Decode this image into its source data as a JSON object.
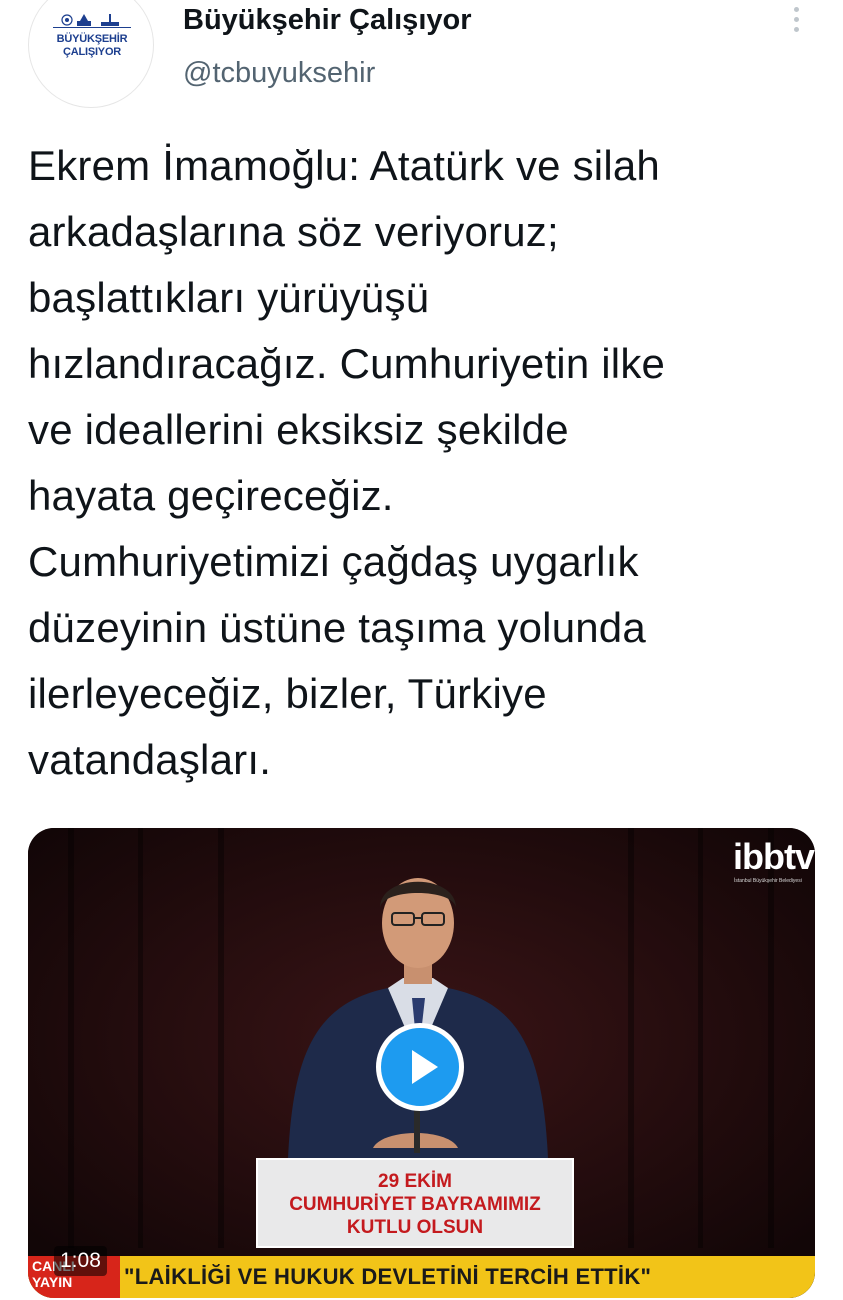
{
  "tweet": {
    "author": {
      "display_name": "Büyükşehir Çalışıyor",
      "handle": "@tcbuyuksehir",
      "avatar_text_line1": "BÜYÜKŞEHİR",
      "avatar_text_line2": "ÇALIŞIYOR"
    },
    "text_lines": [
      "Ekrem İmamoğlu: Atatürk ve silah",
      "arkadaşlarına söz veriyoruz;",
      "başlattıkları yürüyüşü",
      "hızlandıracağız. Cumhuriyetin ilke",
      "ve ideallerini eksiksiz şekilde",
      "hayata geçireceğiz.",
      "Cumhuriyetimizi çağdaş uygarlık",
      "düzeyinin üstüne taşıma yolunda",
      "ilerleyeceğiz, bizler, Türkiye",
      "vatandaşları."
    ],
    "media": {
      "duration": "1:08",
      "play_icon": "play-icon",
      "broadcaster_logo": "ibbtv",
      "broadcaster_subtitle": "İstanbul Büyükşehir Belediyesi",
      "podium_sign": [
        "29 EKİM",
        "CUMHURİYET BAYRAMIMIZ",
        "KUTLU OLSUN"
      ],
      "ticker_tag_line1": "CANLI",
      "ticker_tag_line2": "YAYIN",
      "ticker_headline": "\"LAİKLİĞİ VE HUKUK DEVLETİNİ TERCİH ETTİK\""
    }
  },
  "colors": {
    "text_primary": "#0f1419",
    "text_secondary": "#536471",
    "play_button": "#1d9bf0",
    "ticker_background": "#f2c418",
    "ticker_tag": "#d7251a",
    "sign_text": "#c41a1e"
  },
  "icons": {
    "more_menu": "more-vertical-icon"
  }
}
